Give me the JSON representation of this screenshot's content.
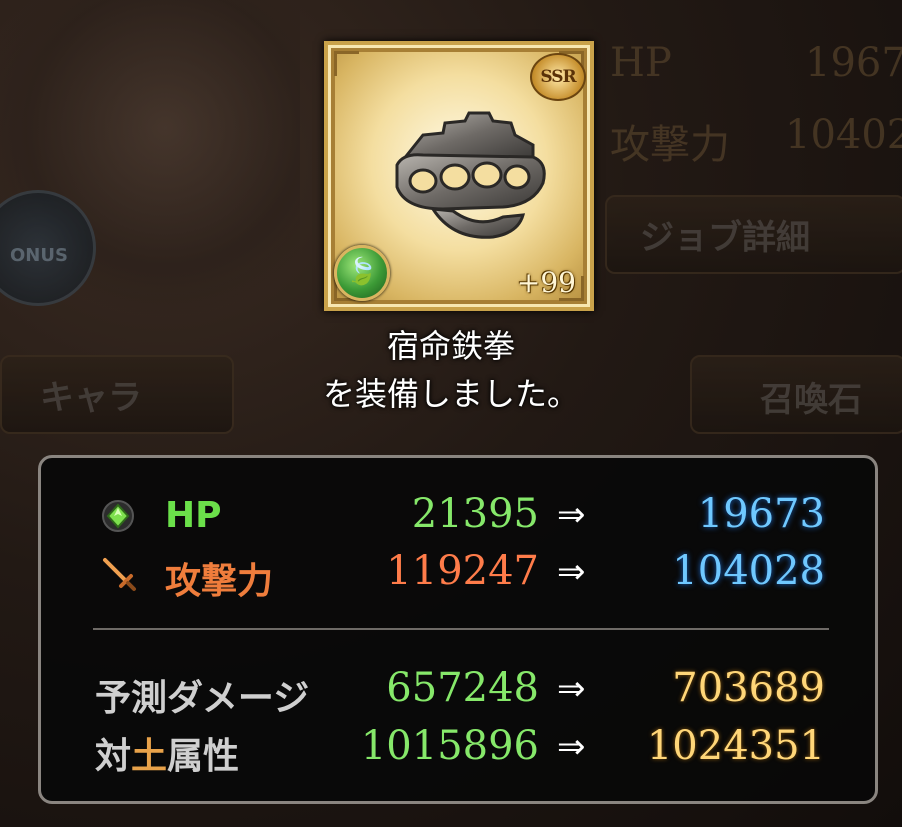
{
  "background": {
    "bonus_text": "ONUS",
    "stats": [
      {
        "label": "HP",
        "value": "1967"
      },
      {
        "label": "攻撃力",
        "value": "10402"
      }
    ],
    "job_detail_button": "ジョブ詳細",
    "character_button": "キャラ",
    "summon_button": "召喚石"
  },
  "item": {
    "rarity": "SSR",
    "plus_level": "+99",
    "element": "wind",
    "element_color": "#3c9a36",
    "frame_color": "#c9a24a"
  },
  "message": {
    "item_name": "宿命鉄拳",
    "equip_text": "を装備しました。"
  },
  "stats": {
    "rows": [
      {
        "label": "HP",
        "icon": "green-diamond-icon",
        "before": "21395",
        "arrow": "⇒",
        "after": "19673",
        "before_color": "#86e86a",
        "after_color": "#6fc8ff"
      },
      {
        "label": "攻撃力",
        "icon": "sword-icon",
        "before": "119247",
        "arrow": "⇒",
        "after": "104028",
        "before_color": "#ff7c4a",
        "after_color": "#6fc8ff"
      }
    ],
    "predictions": [
      {
        "label": "予測ダメージ",
        "before": "657248",
        "arrow": "⇒",
        "after": "703689"
      },
      {
        "label_prefix": "対",
        "label_element": "土",
        "label_suffix": "属性",
        "before": "1015896",
        "arrow": "⇒",
        "after": "1024351"
      }
    ]
  }
}
